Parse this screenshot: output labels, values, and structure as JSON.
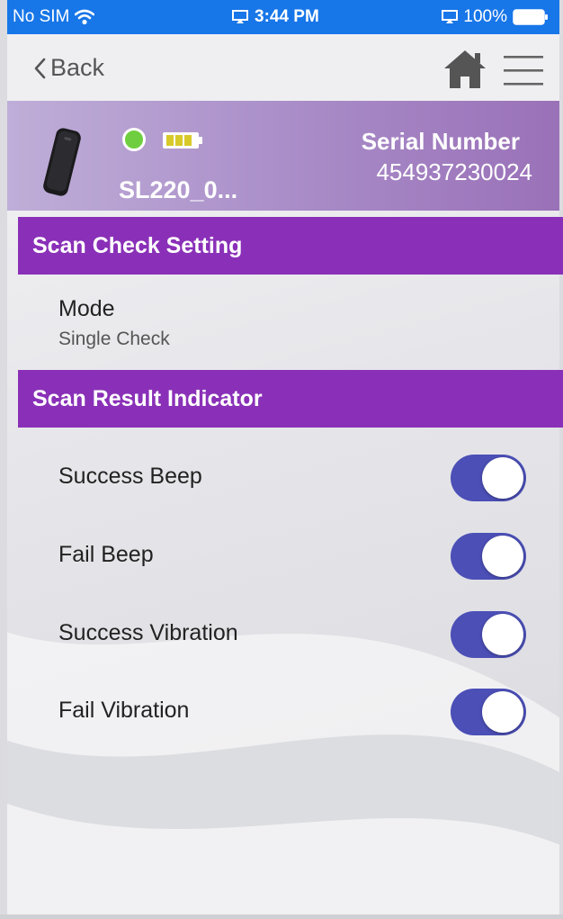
{
  "status_bar": {
    "carrier": "No SIM",
    "time": "3:44 PM",
    "battery_percent": "100%"
  },
  "nav": {
    "back_label": "Back",
    "icons": [
      "chevron-left-icon",
      "home-icon",
      "hamburger-menu-icon"
    ]
  },
  "device": {
    "name": "SL220_0...",
    "connection_status_color": "#6fce3f",
    "serial_label": "Serial Number",
    "serial_value": "454937230024"
  },
  "scan_check": {
    "header": "Scan Check Setting",
    "mode_label": "Mode",
    "mode_value": "Single Check"
  },
  "scan_result": {
    "header": "Scan Result Indicator",
    "toggles": [
      {
        "label": "Success Beep",
        "on": true
      },
      {
        "label": "Fail Beep",
        "on": true
      },
      {
        "label": "Success Vibration",
        "on": true
      },
      {
        "label": "Fail Vibration",
        "on": true
      }
    ]
  },
  "colors": {
    "status_bar": "#1776e8",
    "section_header": "#8a30b8",
    "toggle_on": "#4b4fb6"
  }
}
